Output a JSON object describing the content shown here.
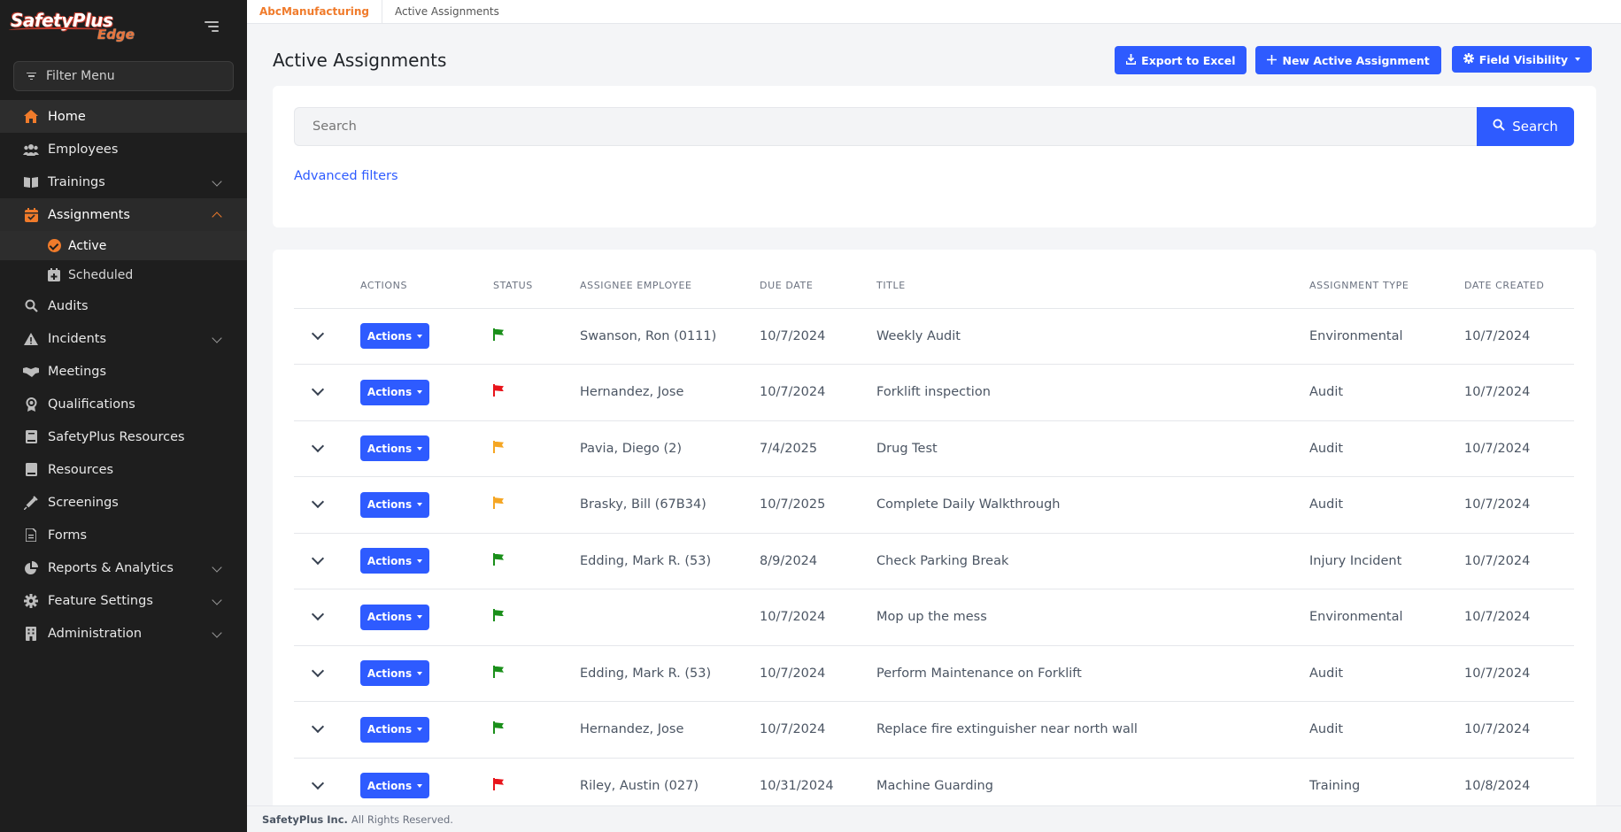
{
  "brand": {
    "logo_main": "SafetyPlus",
    "logo_sub": "Edge"
  },
  "sidebar": {
    "filter_placeholder": "Filter Menu",
    "items": [
      {
        "label": "Home",
        "icon": "home-icon"
      },
      {
        "label": "Employees",
        "icon": "users-icon"
      },
      {
        "label": "Trainings",
        "icon": "book-icon"
      },
      {
        "label": "Assignments",
        "icon": "calendar-check-icon"
      },
      {
        "label": "Audits",
        "icon": "search-icon"
      },
      {
        "label": "Incidents",
        "icon": "warning-icon"
      },
      {
        "label": "Meetings",
        "icon": "handshake-icon"
      },
      {
        "label": "Qualifications",
        "icon": "award-icon"
      },
      {
        "label": "SafetyPlus Resources",
        "icon": "book-icon"
      },
      {
        "label": "Resources",
        "icon": "book-icon"
      },
      {
        "label": "Screenings",
        "icon": "syringe-icon"
      },
      {
        "label": "Forms",
        "icon": "file-icon"
      },
      {
        "label": "Reports & Analytics",
        "icon": "chart-pie-icon"
      },
      {
        "label": "Feature Settings",
        "icon": "gear-icon"
      },
      {
        "label": "Administration",
        "icon": "building-icon"
      }
    ],
    "assignments_sub": [
      {
        "label": "Active"
      },
      {
        "label": "Scheduled"
      }
    ]
  },
  "breadcrumb": {
    "company": "AbcManufacturing",
    "page": "Active Assignments"
  },
  "page": {
    "title": "Active Assignments",
    "export_label": "Export to Excel",
    "new_label": "New Active Assignment",
    "field_visibility_label": "Field Visibility"
  },
  "search": {
    "placeholder": "Search",
    "button_label": "Search",
    "advanced_filters": "Advanced filters"
  },
  "table": {
    "headers": [
      "",
      "Actions",
      "Status",
      "Assignee Employee",
      "Due Date",
      "Title",
      "Assignment Type",
      "Date Created"
    ],
    "actions_label": "Actions",
    "rows": [
      {
        "status_color": "#1a8f1a",
        "assignee": "Swanson, Ron (0111)",
        "due": "10/7/2024",
        "title": "Weekly Audit",
        "type": "Environmental",
        "created": "10/7/2024"
      },
      {
        "status_color": "#e8141b",
        "assignee": "Hernandez, Jose",
        "due": "10/7/2024",
        "title": "Forklift inspection",
        "type": "Audit",
        "created": "10/7/2024"
      },
      {
        "status_color": "#f5a623",
        "assignee": "Pavia, Diego (2)",
        "due": "7/4/2025",
        "title": "Drug Test",
        "type": "Audit",
        "created": "10/7/2024"
      },
      {
        "status_color": "#f5a623",
        "assignee": "Brasky, Bill (67B34)",
        "due": "10/7/2025",
        "title": "Complete Daily Walkthrough",
        "type": "Audit",
        "created": "10/7/2024"
      },
      {
        "status_color": "#1a8f1a",
        "assignee": "Edding, Mark R. (53)",
        "due": "8/9/2024",
        "title": "Check Parking Break",
        "type": "Injury Incident",
        "created": "10/7/2024"
      },
      {
        "status_color": "#1a8f1a",
        "assignee": "",
        "due": "10/7/2024",
        "title": "Mop up the mess",
        "type": "Environmental",
        "created": "10/7/2024"
      },
      {
        "status_color": "#1a8f1a",
        "assignee": "Edding, Mark R. (53)",
        "due": "10/7/2024",
        "title": "Perform Maintenance on Forklift",
        "type": "Audit",
        "created": "10/7/2024"
      },
      {
        "status_color": "#1a8f1a",
        "assignee": "Hernandez, Jose",
        "due": "10/7/2024",
        "title": "Replace fire extinguisher near north wall",
        "type": "Audit",
        "created": "10/7/2024"
      },
      {
        "status_color": "#e8141b",
        "assignee": "Riley, Austin (027)",
        "due": "10/31/2024",
        "title": "Machine Guarding",
        "type": "Training",
        "created": "10/8/2024"
      }
    ]
  },
  "footer": {
    "company": "SafetyPlus Inc.",
    "rights": "All Rights Reserved."
  }
}
